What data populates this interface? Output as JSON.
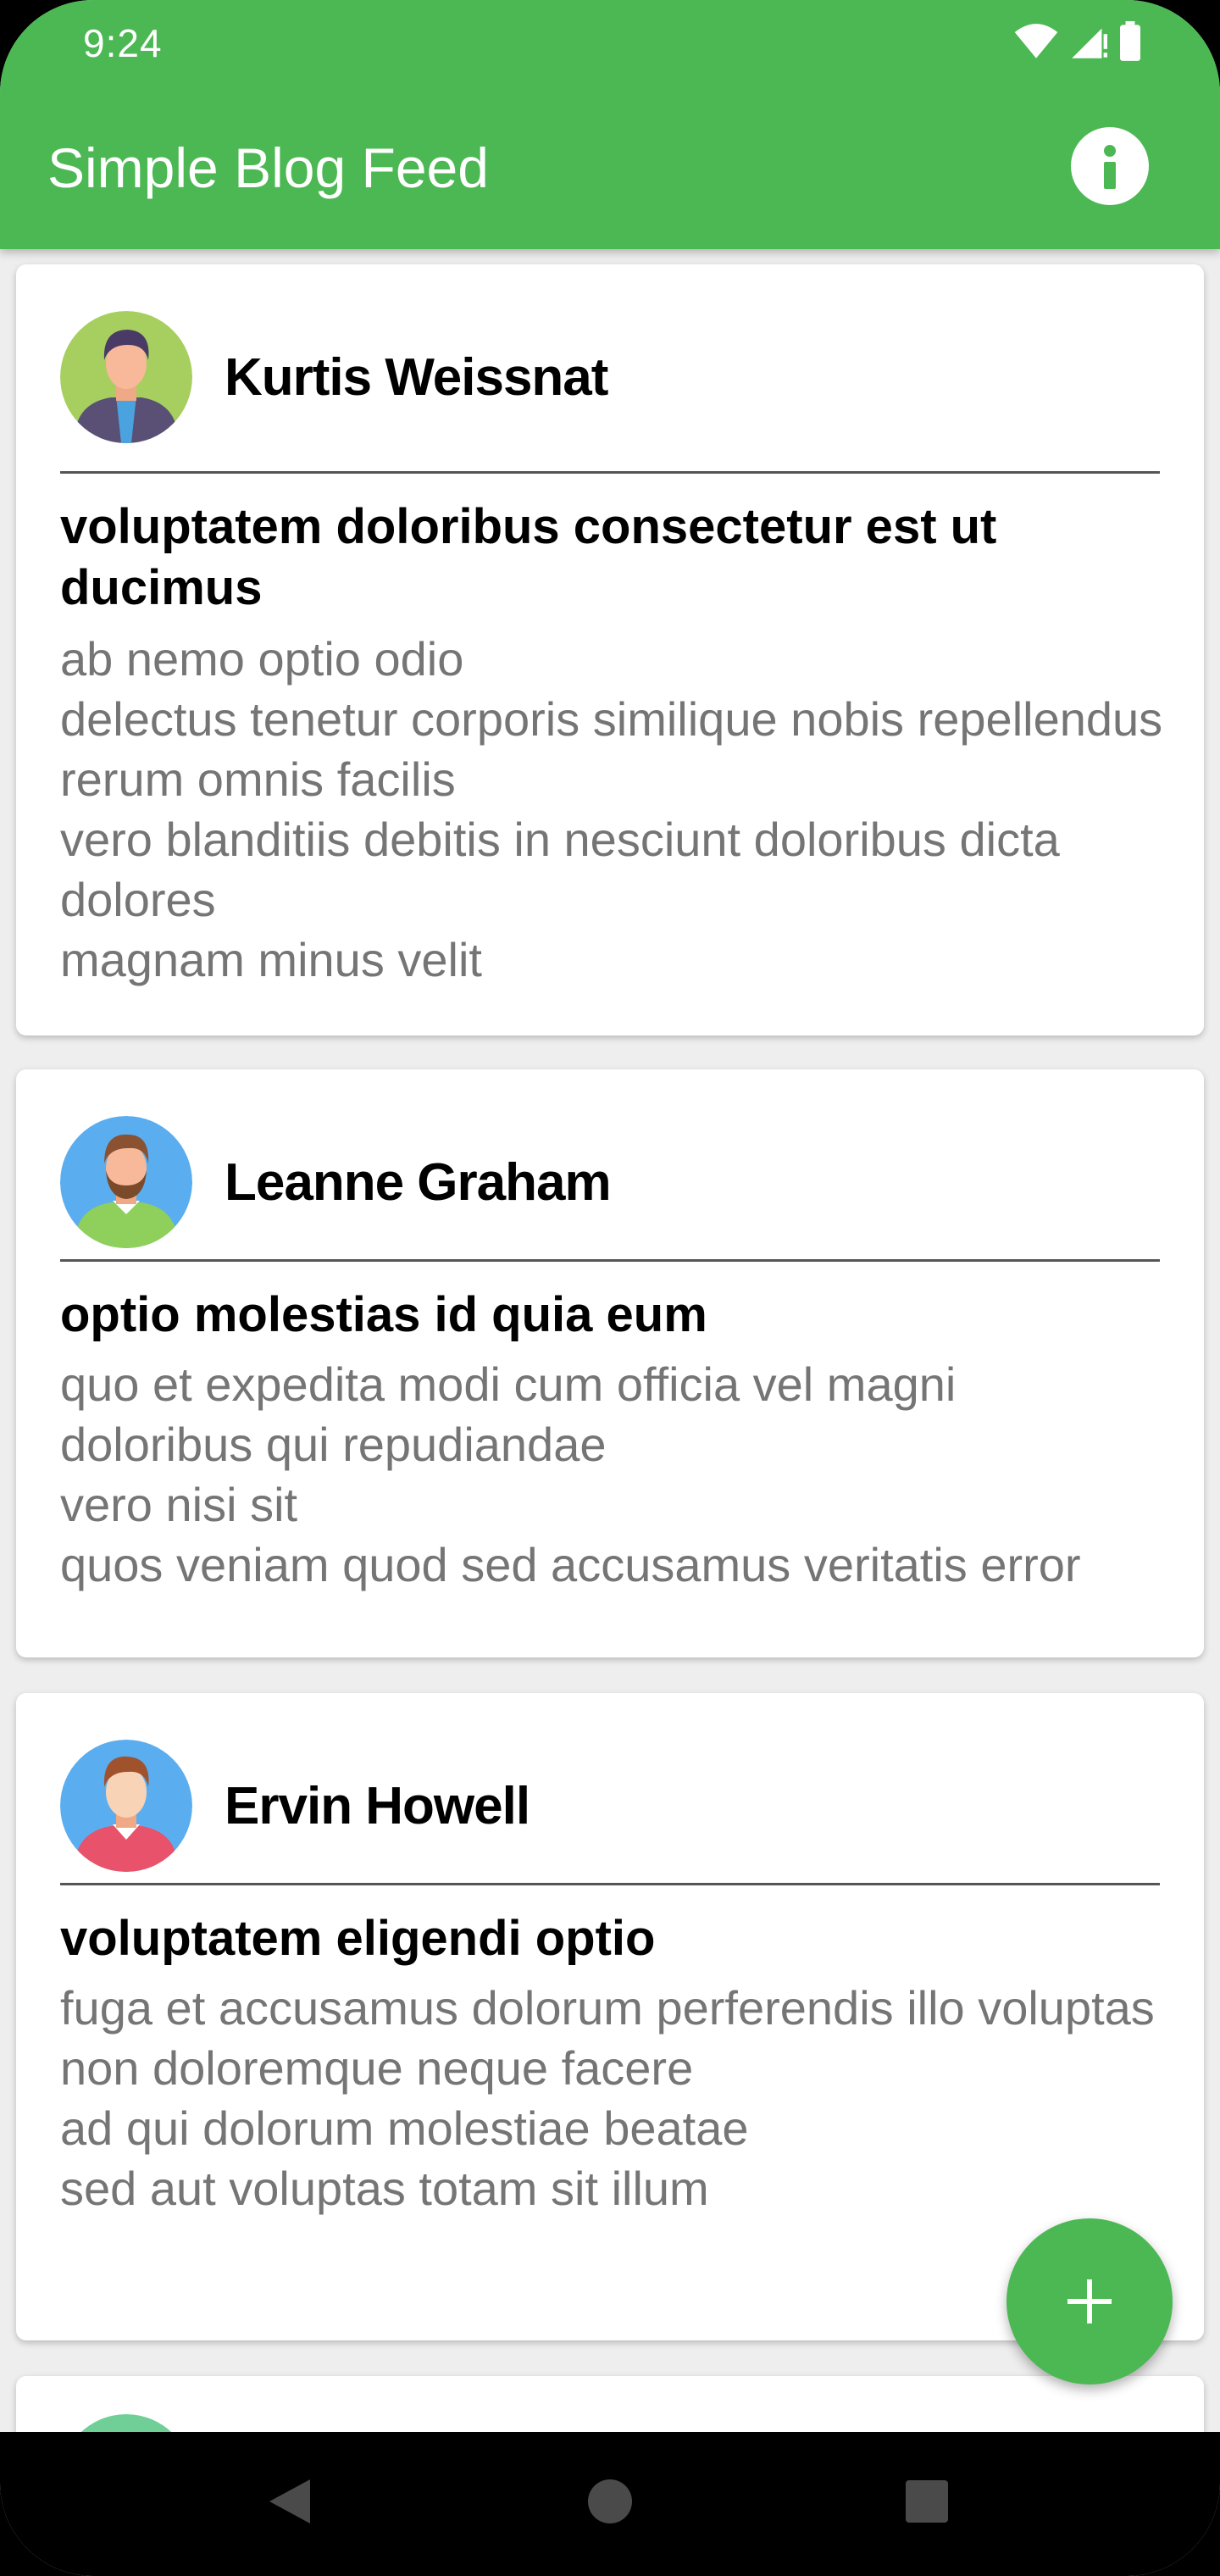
{
  "status_bar": {
    "time": "9:24"
  },
  "app_bar": {
    "title": "Simple Blog Feed",
    "info_icon": "info-icon"
  },
  "posts": [
    {
      "author": "Kurtis Weissnat",
      "avatar": "man-avatar-green",
      "title": "voluptatem doloribus consectetur est ut ducimus",
      "body": "ab nemo optio odio\ndelectus tenetur corporis similique nobis repellendus rerum omnis facilis\nvero blanditiis debitis in nesciunt doloribus dicta dolores\nmagnam minus velit"
    },
    {
      "author": "Leanne Graham",
      "avatar": "bearded-man-avatar-blue",
      "title": "optio molestias id quia eum",
      "body": "quo et expedita modi cum officia vel magni\ndoloribus qui repudiandae\nvero nisi sit\nquos veniam quod sed accusamus veritatis error"
    },
    {
      "author": "Ervin Howell",
      "avatar": "man-avatar-blue-red",
      "title": "voluptatem eligendi optio",
      "body": "fuga et accusamus dolorum perferendis illo voluptas\nnon doloremque neque facere\nad qui dolorum molestiae beatae\nsed aut voluptas totam sit illum"
    }
  ],
  "fab": {
    "icon": "plus-icon"
  },
  "colors": {
    "primary": "#4cb853",
    "body_text": "#757575",
    "title_text": "#000000",
    "background": "#eeeeee"
  }
}
